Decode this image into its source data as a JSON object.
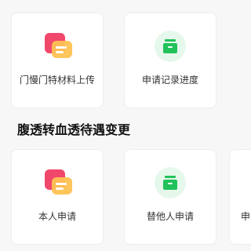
{
  "top_row": {
    "cards": [
      {
        "label": "门慢门特材料上传",
        "icon": "document-upload-icon"
      },
      {
        "label": "申请记录进度",
        "icon": "drawer-icon"
      }
    ]
  },
  "section": {
    "title": "腹透转血透待遇变更"
  },
  "bottom_row": {
    "cards": [
      {
        "label": "本人申请",
        "icon": "document-upload-icon"
      },
      {
        "label": "替他人申请",
        "icon": "drawer-icon"
      },
      {
        "label": "申",
        "icon": "document-upload-icon"
      }
    ]
  },
  "colors": {
    "doc_back": "#f0476b",
    "doc_front": "#ffc254",
    "green": "#22c25a",
    "green_bg": "#e6f8ec"
  }
}
